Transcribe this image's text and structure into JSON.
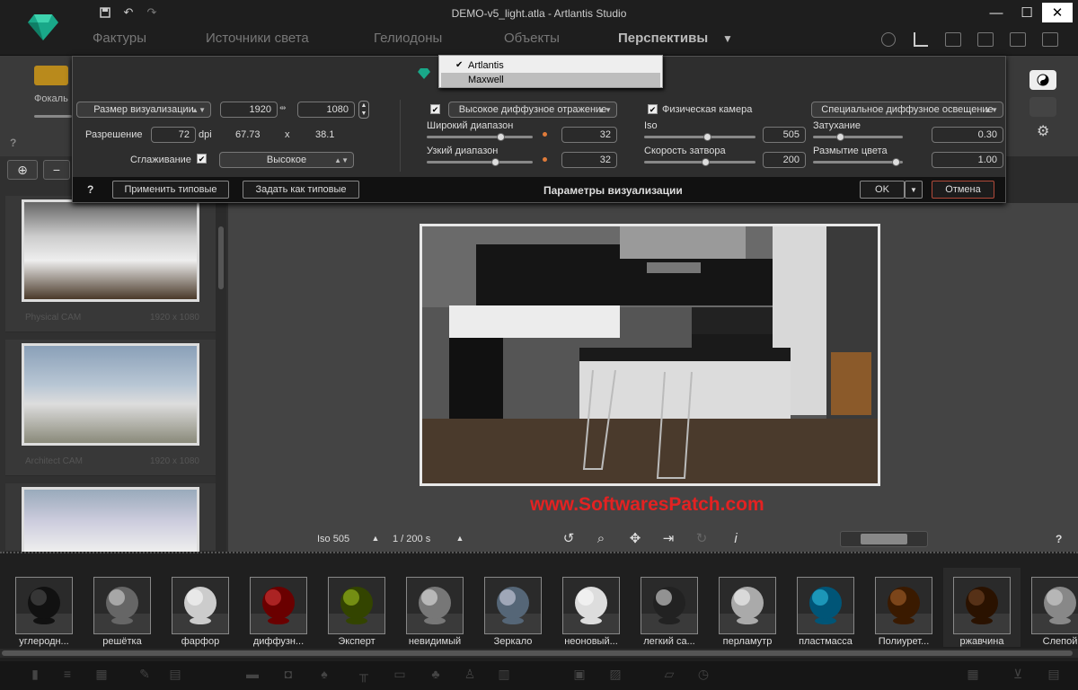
{
  "window": {
    "title": "DEMO-v5_light.atla - Artlantis Studio",
    "minimize": "—",
    "maximize": "☐",
    "close": "✕"
  },
  "main_tabs": [
    "Фактуры",
    "Источники света",
    "Гелиодоны",
    "Объекты",
    "Перспективы"
  ],
  "main_tab_dropdown": "▼",
  "left_strip": {
    "label": "Фокаль"
  },
  "dialog": {
    "engine_dropdown": {
      "options": [
        "Artlantis",
        "Maxwell"
      ],
      "checked": "Artlantis",
      "highlighted": "Maxwell"
    },
    "render_size_label": "Размер визуализации",
    "width": "1920",
    "height": "1080",
    "resolution_label": "Разрешение",
    "dpi_value": "72",
    "dpi_unit": "dpi",
    "print_width": "67.73",
    "times": "x",
    "print_height": "38.1",
    "smoothing_label": "Сглаживание",
    "smoothing_value": "Высокое",
    "diffuse_reflection": "Высокое диффузное отражение",
    "wide_range_label": "Широкий диапазон",
    "wide_range_value": "32",
    "narrow_range_label": "Узкий диапазон",
    "narrow_range_value": "32",
    "physical_camera_label": "Физическая камера",
    "iso_label": "Iso",
    "iso_value": "505",
    "shutter_label": "Скорость затвора",
    "shutter_value": "200",
    "special_diffuse": "Специальное диффузное освещение",
    "attenuation_label": "Затухание",
    "attenuation_value": "0.30",
    "color_bleed_label": "Размытие цвета",
    "color_bleed_value": "1.00",
    "help": "?",
    "apply_default": "Применить типовые",
    "set_default": "Задать как типовые",
    "footer_title": "Параметры визуализации",
    "ok": "OK",
    "ok_arrow": "▼",
    "cancel": "Отмена"
  },
  "thumbnails": [
    {
      "name": "Physical CAM",
      "res": "1920 x 1080"
    },
    {
      "name": "Architect CAM",
      "res": "1920 x 1080"
    },
    {
      "name": "",
      "res": ""
    }
  ],
  "viewport": {
    "iso": "Iso  505",
    "shutter": "1 / 200 s",
    "help": "?",
    "watermark": "www.SoftwaresPatch.com"
  },
  "left_help": "?",
  "materials": [
    "углеродн...",
    "решётка",
    "фарфор",
    "диффузн...",
    "Эксперт",
    "невидимый",
    "Зеркало",
    "неоновый...",
    "легкий са...",
    "перламутр",
    "пластмасса",
    "Полиурет...",
    "ржавчина",
    "Слепой"
  ],
  "colors": {
    "accent_cancel": "#b04a3a",
    "watermark": "#e32222",
    "logo": "#19a889"
  }
}
